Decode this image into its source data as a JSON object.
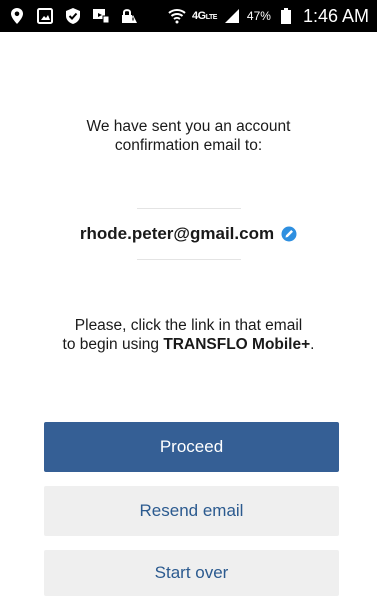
{
  "status_bar": {
    "left_icons": [
      "location-pin-icon",
      "image-icon",
      "shield-check-icon",
      "screen-mirror-icon",
      "lock-warning-icon"
    ],
    "wifi_icon": "wifi-icon",
    "network_label": "4G",
    "network_sublabel": "LTE",
    "signal_icon": "signal-bars-icon",
    "battery_percent": "47%",
    "battery_icon": "battery-icon",
    "time": "1:46 AM"
  },
  "confirmation": {
    "line1": "We have sent you an account",
    "line2": "confirmation email to:"
  },
  "email": {
    "address": "rhode.peter@gmail.com",
    "edit_icon": "edit-pencil-icon",
    "accent_color": "#2e8fe0"
  },
  "instruction": {
    "line1": "Please, click the link in that email",
    "line2_prefix": "to begin using ",
    "app_name": "TRANSFLO Mobile+",
    "line2_suffix": "."
  },
  "buttons": {
    "proceed": "Proceed",
    "resend": "Resend email",
    "start_over": "Start over"
  },
  "colors": {
    "primary": "#355f95",
    "secondary_bg": "#efefef",
    "secondary_text": "#2b5a8f"
  }
}
